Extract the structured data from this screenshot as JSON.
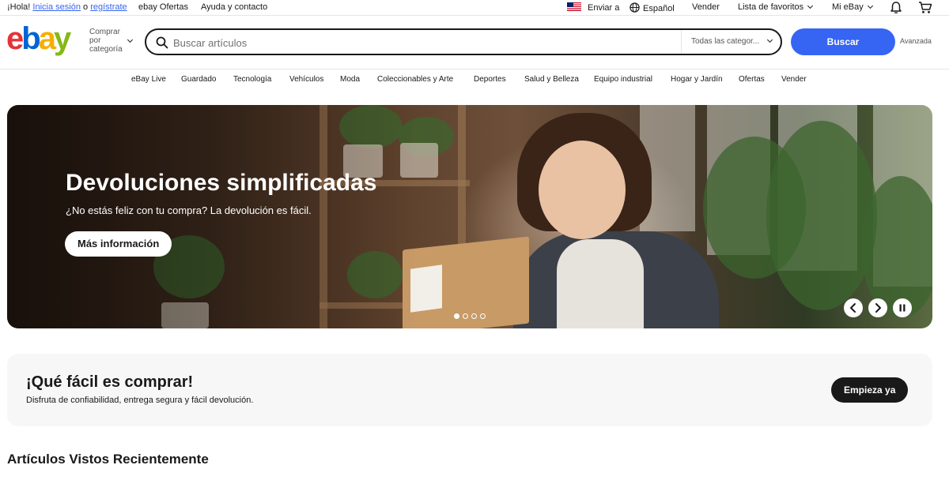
{
  "topbar": {
    "greeting": "¡Hola!",
    "signin": "Inicia sesión",
    "or": "o",
    "register": "regístrate",
    "deals": "ebay Ofertas",
    "help": "Ayuda y contacto",
    "ship_to": "Enviar a",
    "language": "Español",
    "sell": "Vender",
    "watchlist": "Lista de favoritos",
    "my_ebay": "Mi eBay"
  },
  "header": {
    "shop_by_category": "Comprar por categoría",
    "search_placeholder": "Buscar artículos",
    "category_select": "Todas las categor...",
    "search_button": "Buscar",
    "advanced": "Avanzada"
  },
  "nav": {
    "items": [
      "eBay Live",
      "Guardado",
      "Tecnología",
      "Vehículos",
      "Moda",
      "Coleccionables y Arte",
      "Deportes",
      "Salud y Belleza",
      "Equipo industrial",
      "Hogar y Jardín",
      "Ofertas",
      "Vender"
    ]
  },
  "hero": {
    "title": "Devoluciones simplificadas",
    "subtitle": "¿No estás feliz con tu compra? La devolución es fácil.",
    "button": "Más información",
    "slides_total": 4,
    "active_slide": 1
  },
  "promo": {
    "title": "¡Qué fácil es comprar!",
    "subtitle": "Disfruta de confiabilidad, entrega segura y fácil devolución.",
    "button": "Empieza ya"
  },
  "recent": {
    "title": "Artículos Vistos Recientemente"
  },
  "colors": {
    "accent": "#3665f3",
    "text": "#191919",
    "promo_bg": "#f7f7f7",
    "logo_e": "#e53238",
    "logo_b": "#0064d2",
    "logo_a": "#f5af02",
    "logo_y": "#86b817"
  }
}
